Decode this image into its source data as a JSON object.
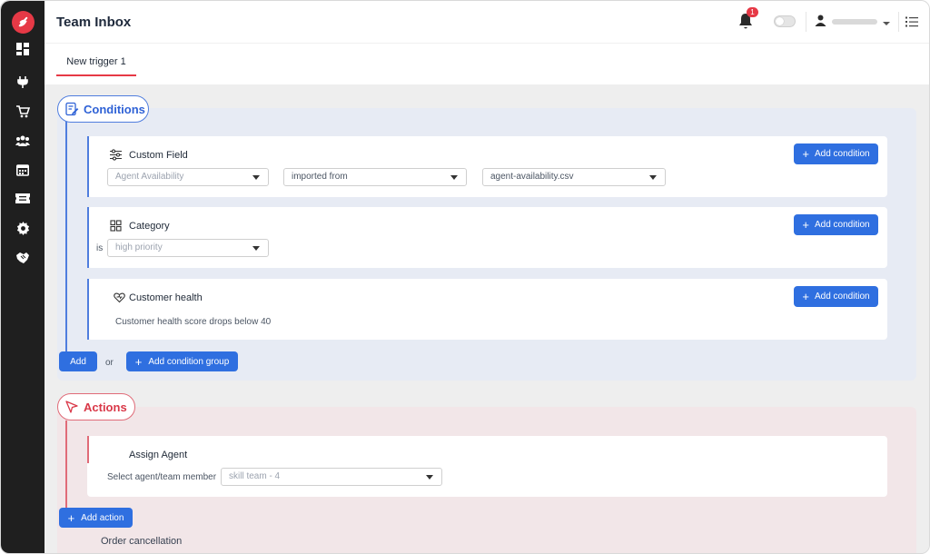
{
  "header": {
    "title": "Team Inbox",
    "notification_count": "1"
  },
  "tabs": [
    {
      "label": "New trigger 1",
      "active": true
    }
  ],
  "conditions": {
    "label": "Conditions",
    "cards": [
      {
        "title": "Custom Field",
        "icon": "sliders-icon",
        "add_label": "Add condition",
        "selects": [
          {
            "value": "Agent Availability",
            "placeholder": true
          },
          {
            "value": "imported from",
            "placeholder": false
          },
          {
            "value": "agent-availability.csv",
            "placeholder": false
          }
        ]
      },
      {
        "title": "Category",
        "icon": "grid-icon",
        "add_label": "Add condition",
        "prefix": "is",
        "selects": [
          {
            "value": "high priority",
            "placeholder": true
          }
        ]
      },
      {
        "title": "Customer health",
        "icon": "heart-icon",
        "add_label": "Add condition",
        "description": "Customer health score drops below 40"
      }
    ],
    "add_label": "Add",
    "or_label": "or",
    "add_group_label": "Add condition group"
  },
  "actions": {
    "label": "Actions",
    "cards": [
      {
        "title": "Assign Agent",
        "field_label": "Select agent/team member",
        "select_value": "skill team - 4"
      }
    ],
    "add_action_label": "Add action",
    "footer_text": "Order cancellation"
  },
  "colors": {
    "brand_red": "#e63946",
    "primary_blue": "#2f6fe0",
    "conditions_bg": "#e7ebf4",
    "actions_bg": "#f2e6e8"
  }
}
